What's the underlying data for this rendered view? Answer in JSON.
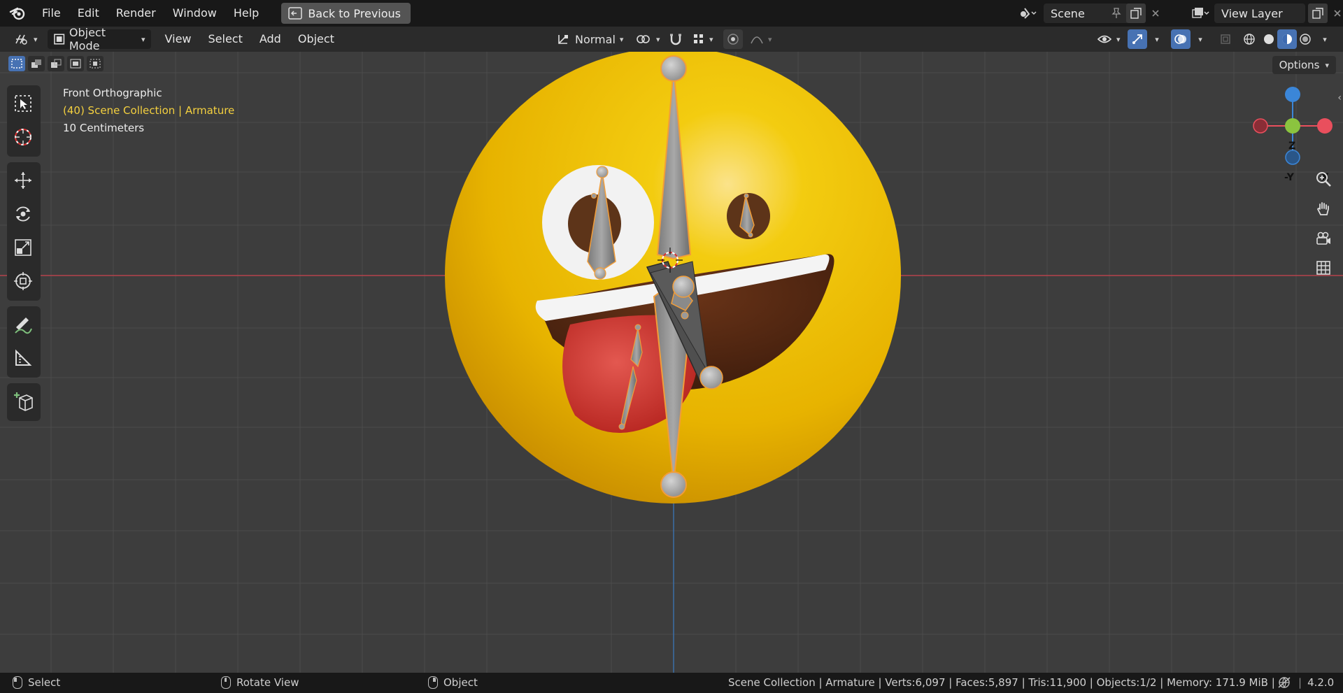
{
  "menu": {
    "items": [
      "File",
      "Edit",
      "Render",
      "Window",
      "Help"
    ],
    "back_button": "Back to Previous"
  },
  "scene": {
    "name": "Scene",
    "view_layer": "View Layer"
  },
  "header": {
    "mode": "Object Mode",
    "menus": [
      "View",
      "Select",
      "Add",
      "Object"
    ],
    "orientation": "Normal",
    "options": "Options"
  },
  "overlay": {
    "view_name": "Front Orthographic",
    "collection_info": "(40) Scene Collection | Armature",
    "scale": "10 Centimeters"
  },
  "gizmo": {
    "z": "Z",
    "y": "-Y",
    "x": "X"
  },
  "status": {
    "left": "Select",
    "middle": "Rotate View",
    "right": "Object",
    "stats": "Scene Collection | Armature | Verts:6,097 | Faces:5,897 | Tris:11,900 | Objects:1/2 | Memory: 171.9 MiB |",
    "version": "4.2.0"
  },
  "colors": {
    "accent": "#4772b3",
    "selection_orange": "#f29d39",
    "emoji_yellow": "#f2c200",
    "x_axis": "#e94f5d",
    "y_axis": "#8bc43f",
    "z_axis": "#3b86d8"
  }
}
